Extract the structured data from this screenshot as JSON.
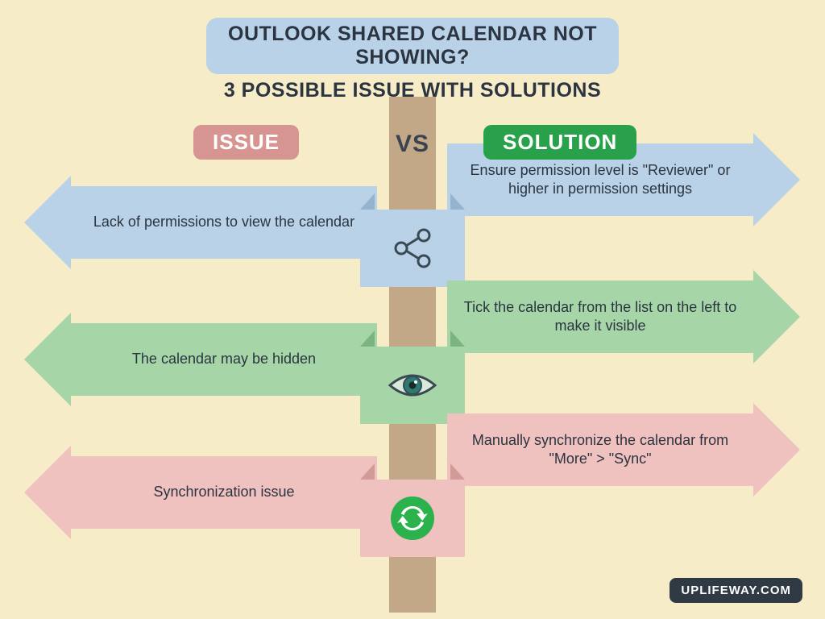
{
  "header": {
    "title": "OUTLOOK SHARED CALENDAR NOT SHOWING?",
    "subtitle": "3 POSSIBLE ISSUE WITH SOLUTIONS"
  },
  "columns": {
    "issue_label": "ISSUE",
    "vs_label": "VS",
    "solution_label": "SOLUTION"
  },
  "rows": [
    {
      "issue": "Lack of permissions to view the calendar",
      "solution": "Ensure permission level is \"Reviewer\" or higher in permission settings",
      "icon": "share-icon",
      "color": "blue"
    },
    {
      "issue": "The calendar may be hidden",
      "solution": "Tick the calendar from the list on the left to make it visible",
      "icon": "eye-icon",
      "color": "green"
    },
    {
      "issue": "Synchronization issue",
      "solution": "Manually synchronize the calendar from \"More\" > \"Sync\"",
      "icon": "sync-icon",
      "color": "pink"
    }
  ],
  "watermark": "UPLIFEWAY.COM"
}
